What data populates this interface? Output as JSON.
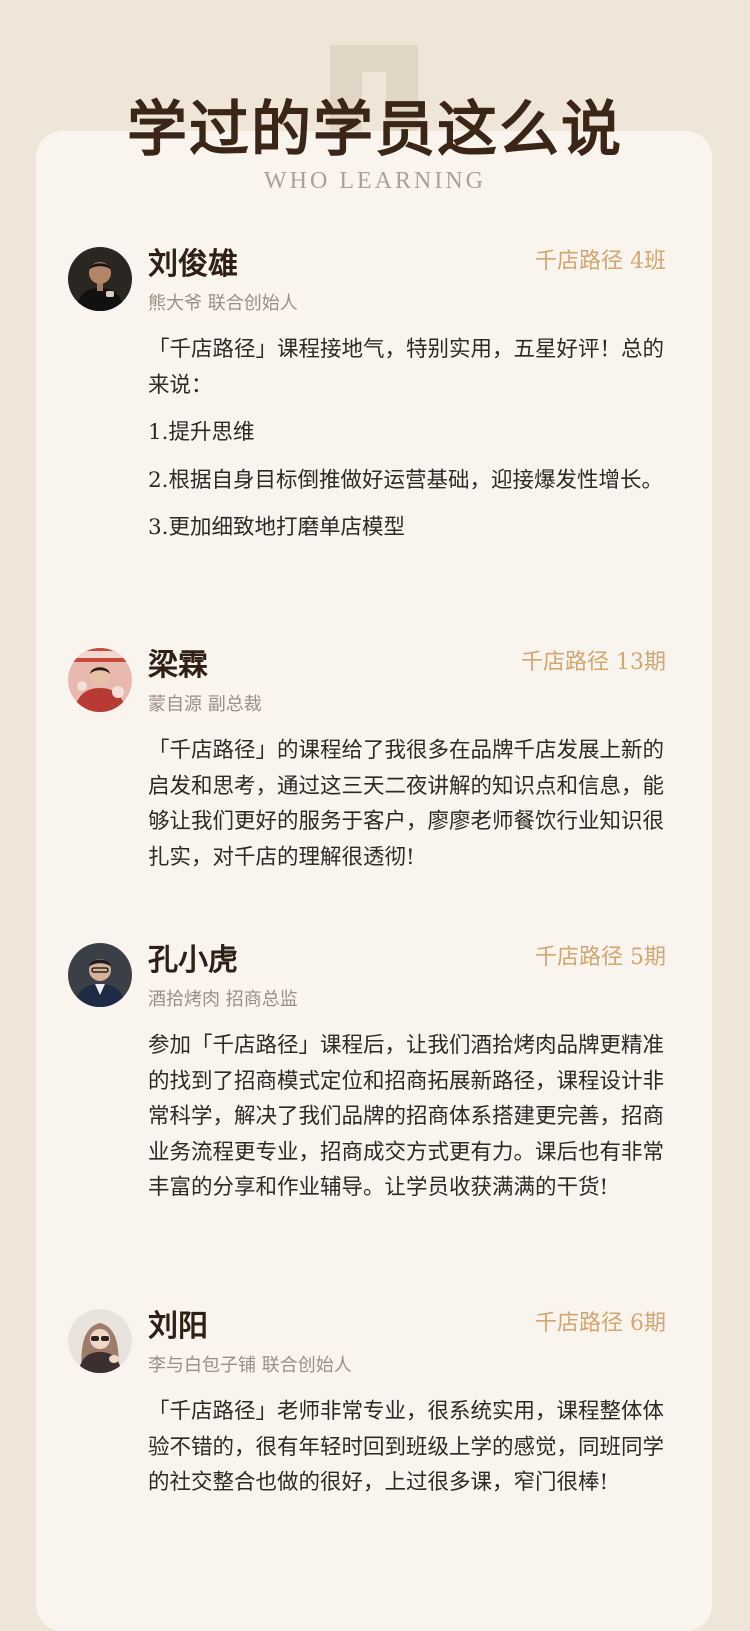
{
  "header": {
    "title": "学过的学员这么说",
    "subtitle": "WHO LEARNING"
  },
  "testimonials": [
    {
      "name": "刘俊雄",
      "cohort": "千店路径 4班",
      "role": "熊大爷 联合创始人",
      "paragraphs": [
        "「千店路径」课程接地气，特别实用，五星好评！总的来说：",
        "1.提升思维",
        "2.根据自身目标倒推做好运营基础，迎接爆发性增长。",
        "3.更加细致地打磨单店模型"
      ]
    },
    {
      "name": "梁霖",
      "cohort": "千店路径 13期",
      "role": "蒙自源 副总裁",
      "paragraphs": [
        "「千店路径」的课程给了我很多在品牌千店发展上新的启发和思考，通过这三天二夜讲解的知识点和信息，能够让我们更好的服务于客户，廖廖老师餐饮行业知识很扎实，对千店的理解很透彻!"
      ]
    },
    {
      "name": "孔小虎",
      "cohort": "千店路径 5期",
      "role": "酒拾烤肉 招商总监",
      "paragraphs": [
        "参加「千店路径」课程后，让我们酒拾烤肉品牌更精准的找到了招商模式定位和招商拓展新路径，课程设计非常科学，解决了我们品牌的招商体系搭建更完善，招商业务流程更专业，招商成交方式更有力。课后也有非常丰富的分享和作业辅导。让学员收获满满的干货!"
      ]
    },
    {
      "name": "刘阳",
      "cohort": "千店路径 6期",
      "role": "李与白包子铺 联合创始人",
      "paragraphs": [
        "「千店路径」老师非常专业，很系统实用，课程整体体验不错的，很有年轻时回到班级上学的感觉，同班同学的社交整合也做的很好，上过很多课，窄门很棒!"
      ]
    }
  ]
}
